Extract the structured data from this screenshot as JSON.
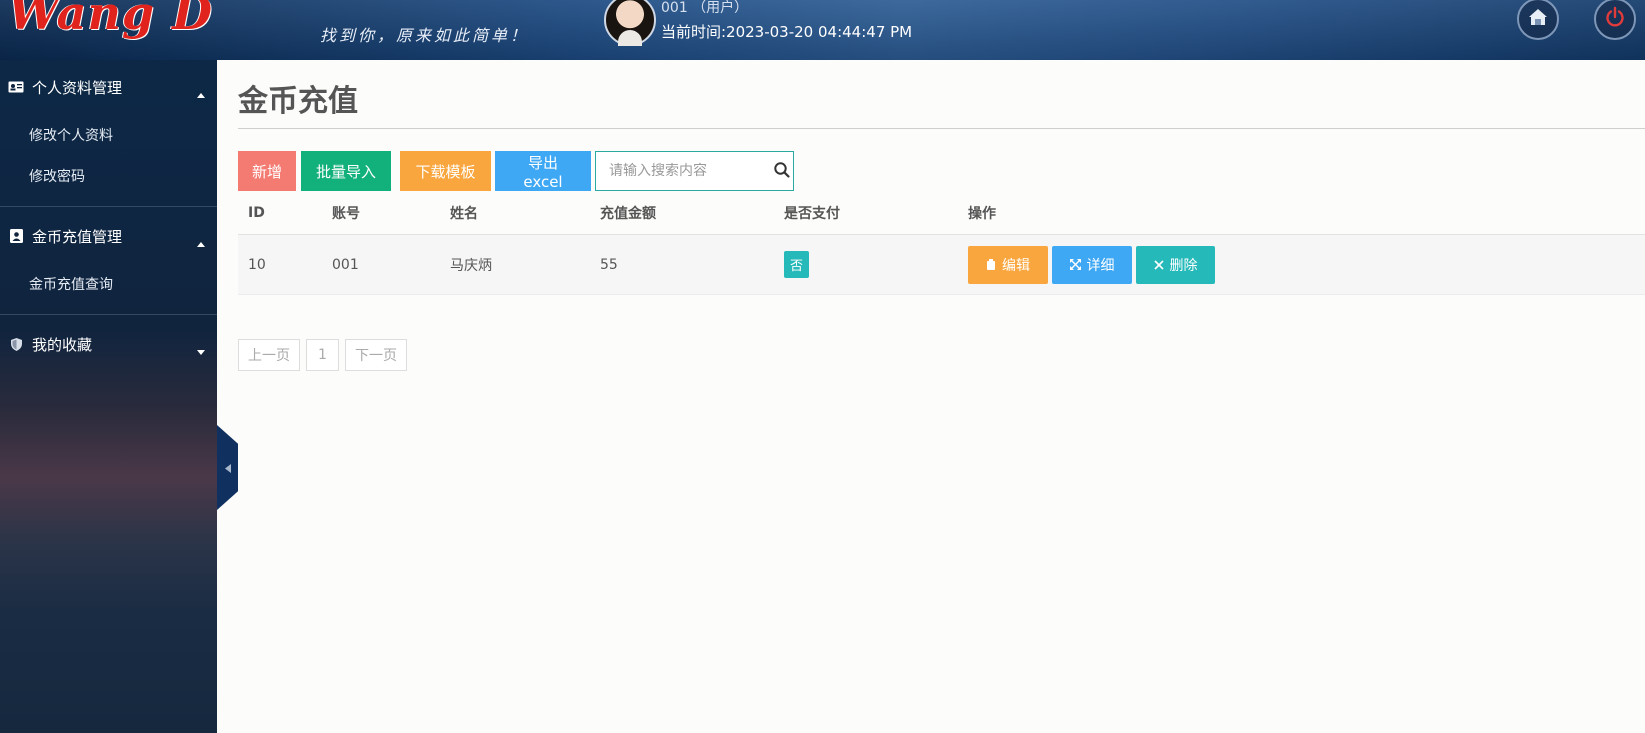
{
  "header": {
    "logo_text": "Wang D",
    "slogan": "找到你，原来如此简单！",
    "user_label": "001 （用户）",
    "time_label": "当前时间:2023-03-20 04:44:47 PM"
  },
  "sidebar": {
    "groups": [
      {
        "title": "个人资料管理",
        "icon": "id-card-icon",
        "expanded": true,
        "items": [
          "修改个人资料",
          "修改密码"
        ]
      },
      {
        "title": "金币充值管理",
        "icon": "user-badge-icon",
        "expanded": true,
        "items": [
          "金币充值查询"
        ]
      },
      {
        "title": "我的收藏",
        "icon": "shield-icon",
        "expanded": false,
        "items": []
      }
    ]
  },
  "main": {
    "title": "金币充值",
    "toolbar": {
      "add_label": "新增",
      "import_label": "批量导入",
      "template_label": "下载模板",
      "export_label": "导出excel",
      "search_placeholder": "请输入搜索内容"
    },
    "table": {
      "headers": [
        "ID",
        "账号",
        "姓名",
        "充值金额",
        "是否支付",
        "操作"
      ],
      "rows": [
        {
          "id": "10",
          "account": "001",
          "name": "马庆炳",
          "amount": "55",
          "paid": "否"
        }
      ],
      "actions": {
        "edit": "编辑",
        "detail": "详细",
        "delete": "删除"
      }
    },
    "pagination": {
      "prev": "上一页",
      "page": "1",
      "next": "下一页"
    }
  },
  "colors": {
    "add": "#f47b72",
    "import": "#12b07a",
    "template": "#f9a63e",
    "export": "#3fa8f4",
    "teal": "#26b9b9"
  }
}
